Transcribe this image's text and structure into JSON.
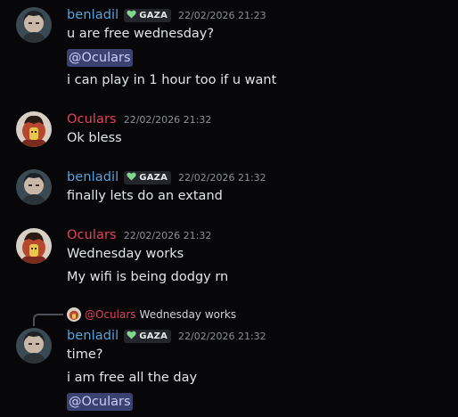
{
  "messages": [
    {
      "username": "benladil",
      "tag": "GAZA",
      "timestamp": "22/02/2026 21:23",
      "lines": [
        "u are free wednesday?",
        "@Oculars",
        "i can play in 1 hour too if u want"
      ]
    },
    {
      "username": "Oculars",
      "timestamp": "22/02/2026 21:32",
      "lines": [
        "Ok bless"
      ]
    },
    {
      "username": "benladil",
      "tag": "GAZA",
      "timestamp": "22/02/2026 21:32",
      "lines": [
        "finally lets do an extand"
      ]
    },
    {
      "username": "Oculars",
      "timestamp": "22/02/2026 21:32",
      "lines": [
        "Wednesday works",
        "My wifi is being dodgy rn"
      ]
    },
    {
      "reply": {
        "username": "@Oculars",
        "text": "Wednesday works"
      },
      "username": "benladil",
      "tag": "GAZA",
      "timestamp": "22/02/2026 21:32",
      "lines": [
        "time?",
        "i am free all the day",
        "@Oculars"
      ]
    }
  ],
  "colors": {
    "background": "#070709",
    "benladil": "#5aa2de",
    "oculars": "#e0445f",
    "mention_bg": "#3c4270",
    "mention_text": "#c9cdfb",
    "tag_heart": "#7fd88b"
  },
  "icons": {
    "tag": "green-heart-icon"
  }
}
